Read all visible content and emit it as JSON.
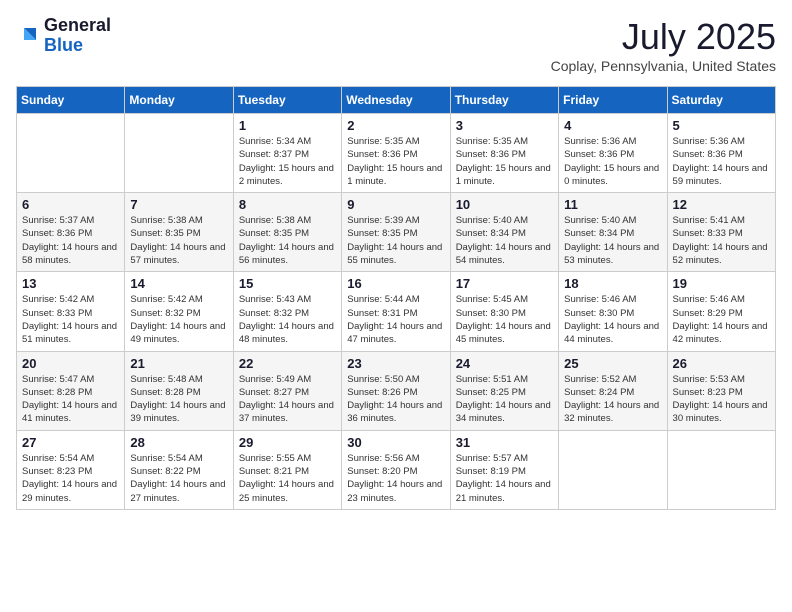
{
  "logo": {
    "general": "General",
    "blue": "Blue"
  },
  "title": "July 2025",
  "location": "Coplay, Pennsylvania, United States",
  "days_of_week": [
    "Sunday",
    "Monday",
    "Tuesday",
    "Wednesday",
    "Thursday",
    "Friday",
    "Saturday"
  ],
  "weeks": [
    [
      {
        "day": "",
        "info": ""
      },
      {
        "day": "",
        "info": ""
      },
      {
        "day": "1",
        "info": "Sunrise: 5:34 AM\nSunset: 8:37 PM\nDaylight: 15 hours and 2 minutes."
      },
      {
        "day": "2",
        "info": "Sunrise: 5:35 AM\nSunset: 8:36 PM\nDaylight: 15 hours and 1 minute."
      },
      {
        "day": "3",
        "info": "Sunrise: 5:35 AM\nSunset: 8:36 PM\nDaylight: 15 hours and 1 minute."
      },
      {
        "day": "4",
        "info": "Sunrise: 5:36 AM\nSunset: 8:36 PM\nDaylight: 15 hours and 0 minutes."
      },
      {
        "day": "5",
        "info": "Sunrise: 5:36 AM\nSunset: 8:36 PM\nDaylight: 14 hours and 59 minutes."
      }
    ],
    [
      {
        "day": "6",
        "info": "Sunrise: 5:37 AM\nSunset: 8:36 PM\nDaylight: 14 hours and 58 minutes."
      },
      {
        "day": "7",
        "info": "Sunrise: 5:38 AM\nSunset: 8:35 PM\nDaylight: 14 hours and 57 minutes."
      },
      {
        "day": "8",
        "info": "Sunrise: 5:38 AM\nSunset: 8:35 PM\nDaylight: 14 hours and 56 minutes."
      },
      {
        "day": "9",
        "info": "Sunrise: 5:39 AM\nSunset: 8:35 PM\nDaylight: 14 hours and 55 minutes."
      },
      {
        "day": "10",
        "info": "Sunrise: 5:40 AM\nSunset: 8:34 PM\nDaylight: 14 hours and 54 minutes."
      },
      {
        "day": "11",
        "info": "Sunrise: 5:40 AM\nSunset: 8:34 PM\nDaylight: 14 hours and 53 minutes."
      },
      {
        "day": "12",
        "info": "Sunrise: 5:41 AM\nSunset: 8:33 PM\nDaylight: 14 hours and 52 minutes."
      }
    ],
    [
      {
        "day": "13",
        "info": "Sunrise: 5:42 AM\nSunset: 8:33 PM\nDaylight: 14 hours and 51 minutes."
      },
      {
        "day": "14",
        "info": "Sunrise: 5:42 AM\nSunset: 8:32 PM\nDaylight: 14 hours and 49 minutes."
      },
      {
        "day": "15",
        "info": "Sunrise: 5:43 AM\nSunset: 8:32 PM\nDaylight: 14 hours and 48 minutes."
      },
      {
        "day": "16",
        "info": "Sunrise: 5:44 AM\nSunset: 8:31 PM\nDaylight: 14 hours and 47 minutes."
      },
      {
        "day": "17",
        "info": "Sunrise: 5:45 AM\nSunset: 8:30 PM\nDaylight: 14 hours and 45 minutes."
      },
      {
        "day": "18",
        "info": "Sunrise: 5:46 AM\nSunset: 8:30 PM\nDaylight: 14 hours and 44 minutes."
      },
      {
        "day": "19",
        "info": "Sunrise: 5:46 AM\nSunset: 8:29 PM\nDaylight: 14 hours and 42 minutes."
      }
    ],
    [
      {
        "day": "20",
        "info": "Sunrise: 5:47 AM\nSunset: 8:28 PM\nDaylight: 14 hours and 41 minutes."
      },
      {
        "day": "21",
        "info": "Sunrise: 5:48 AM\nSunset: 8:28 PM\nDaylight: 14 hours and 39 minutes."
      },
      {
        "day": "22",
        "info": "Sunrise: 5:49 AM\nSunset: 8:27 PM\nDaylight: 14 hours and 37 minutes."
      },
      {
        "day": "23",
        "info": "Sunrise: 5:50 AM\nSunset: 8:26 PM\nDaylight: 14 hours and 36 minutes."
      },
      {
        "day": "24",
        "info": "Sunrise: 5:51 AM\nSunset: 8:25 PM\nDaylight: 14 hours and 34 minutes."
      },
      {
        "day": "25",
        "info": "Sunrise: 5:52 AM\nSunset: 8:24 PM\nDaylight: 14 hours and 32 minutes."
      },
      {
        "day": "26",
        "info": "Sunrise: 5:53 AM\nSunset: 8:23 PM\nDaylight: 14 hours and 30 minutes."
      }
    ],
    [
      {
        "day": "27",
        "info": "Sunrise: 5:54 AM\nSunset: 8:23 PM\nDaylight: 14 hours and 29 minutes."
      },
      {
        "day": "28",
        "info": "Sunrise: 5:54 AM\nSunset: 8:22 PM\nDaylight: 14 hours and 27 minutes."
      },
      {
        "day": "29",
        "info": "Sunrise: 5:55 AM\nSunset: 8:21 PM\nDaylight: 14 hours and 25 minutes."
      },
      {
        "day": "30",
        "info": "Sunrise: 5:56 AM\nSunset: 8:20 PM\nDaylight: 14 hours and 23 minutes."
      },
      {
        "day": "31",
        "info": "Sunrise: 5:57 AM\nSunset: 8:19 PM\nDaylight: 14 hours and 21 minutes."
      },
      {
        "day": "",
        "info": ""
      },
      {
        "day": "",
        "info": ""
      }
    ]
  ]
}
